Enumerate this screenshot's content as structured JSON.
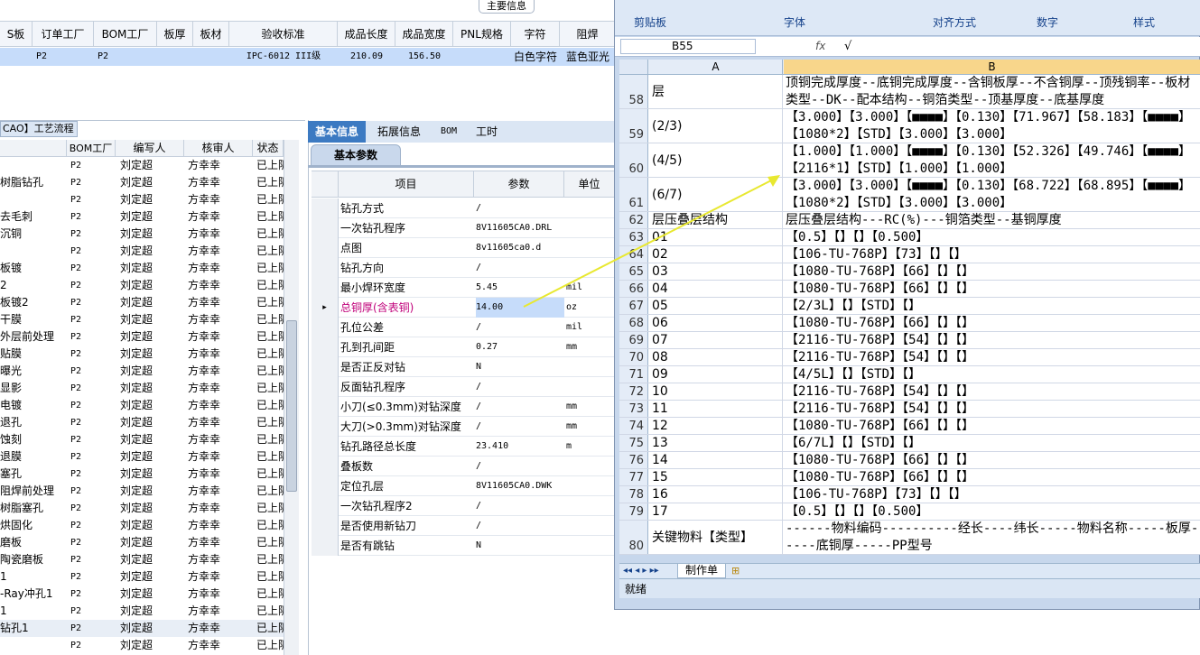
{
  "top_grid": {
    "group_title": "主要信息",
    "headers": [
      "S板",
      "订单工厂",
      "BOM工厂",
      "板厚",
      "板材",
      "验收标准",
      "成品长度",
      "成品宽度",
      "PNL规格",
      "字符",
      "阻焊"
    ],
    "row": [
      "",
      "P2",
      "P2",
      "",
      "",
      "IPC-6012 III级",
      "210.09",
      "156.50",
      "",
      "白色字符",
      "蓝色亚光"
    ]
  },
  "left_list": {
    "title": "CAO】工艺流程",
    "headers": [
      "",
      "BOM工厂",
      "编写人",
      "核审人",
      "状态"
    ],
    "rows": [
      [
        "",
        "P2",
        "刘定超",
        "方幸幸",
        "已上阪"
      ],
      [
        "树脂钻孔",
        "P2",
        "刘定超",
        "方幸幸",
        "已上阪"
      ],
      [
        "",
        "P2",
        "刘定超",
        "方幸幸",
        "已上阪"
      ],
      [
        "去毛刺",
        "P2",
        "刘定超",
        "方幸幸",
        "已上阪"
      ],
      [
        "沉铜",
        "P2",
        "刘定超",
        "方幸幸",
        "已上阪"
      ],
      [
        "",
        "P2",
        "刘定超",
        "方幸幸",
        "已上阪"
      ],
      [
        "板镀",
        "P2",
        "刘定超",
        "方幸幸",
        "已上阪"
      ],
      [
        "2",
        "P2",
        "刘定超",
        "方幸幸",
        "已上阪"
      ],
      [
        "板镀2",
        "P2",
        "刘定超",
        "方幸幸",
        "已上阪"
      ],
      [
        "干膜",
        "P2",
        "刘定超",
        "方幸幸",
        "已上阪"
      ],
      [
        "外层前处理",
        "P2",
        "刘定超",
        "方幸幸",
        "已上阪"
      ],
      [
        "贴膜",
        "P2",
        "刘定超",
        "方幸幸",
        "已上阪"
      ],
      [
        "曝光",
        "P2",
        "刘定超",
        "方幸幸",
        "已上阪"
      ],
      [
        "显影",
        "P2",
        "刘定超",
        "方幸幸",
        "已上阪"
      ],
      [
        "电镀",
        "P2",
        "刘定超",
        "方幸幸",
        "已上阪"
      ],
      [
        "退孔",
        "P2",
        "刘定超",
        "方幸幸",
        "已上阪"
      ],
      [
        "蚀刻",
        "P2",
        "刘定超",
        "方幸幸",
        "已上阪"
      ],
      [
        "退膜",
        "P2",
        "刘定超",
        "方幸幸",
        "已上阪"
      ],
      [
        "塞孔",
        "P2",
        "刘定超",
        "方幸幸",
        "已上阪"
      ],
      [
        "阻焊前处理",
        "P2",
        "刘定超",
        "方幸幸",
        "已上阪"
      ],
      [
        "树脂塞孔",
        "P2",
        "刘定超",
        "方幸幸",
        "已上阪"
      ],
      [
        "烘固化",
        "P2",
        "刘定超",
        "方幸幸",
        "已上阪"
      ],
      [
        "磨板",
        "P2",
        "刘定超",
        "方幸幸",
        "已上阪"
      ],
      [
        "陶瓷磨板",
        "P2",
        "刘定超",
        "方幸幸",
        "已上阪"
      ],
      [
        "1",
        "P2",
        "刘定超",
        "方幸幸",
        "已上阪"
      ],
      [
        "-Ray冲孔1",
        "P2",
        "刘定超",
        "方幸幸",
        "已上阪"
      ],
      [
        "1",
        "P2",
        "刘定超",
        "方幸幸",
        "已上阪"
      ],
      [
        "钻孔1",
        "P2",
        "刘定超",
        "方幸幸",
        "已上阪"
      ],
      [
        "",
        "P2",
        "刘定超",
        "方幸幸",
        "已上阪"
      ]
    ]
  },
  "mid_panel": {
    "tabs": [
      "基本信息",
      "拓展信息",
      "BOM",
      "工时"
    ],
    "subtab": "基本参数",
    "headers": [
      "项目",
      "参数",
      "单位"
    ],
    "rows": [
      [
        "钻孔方式",
        "/",
        ""
      ],
      [
        "一次钻孔程序",
        "8V11605CA0.DRL",
        ""
      ],
      [
        "点图",
        "8v11605ca0.d",
        ""
      ],
      [
        "钻孔方向",
        "/",
        ""
      ],
      [
        "最小焊环宽度",
        "5.45",
        "mil"
      ],
      [
        "总铜厚(含表铜)",
        "14.00",
        "oz"
      ],
      [
        "孔位公差",
        "/",
        "mil"
      ],
      [
        "孔到孔间距",
        "0.27",
        "mm"
      ],
      [
        "是否正反对钻",
        "N",
        ""
      ],
      [
        "反面钻孔程序",
        "/",
        ""
      ],
      [
        "小刀(≤0.3mm)对钻深度",
        "/",
        "mm"
      ],
      [
        "大刀(>0.3mm)对钻深度",
        "/",
        "mm"
      ],
      [
        "钻孔路径总长度",
        "23.410",
        "m"
      ],
      [
        "叠板数",
        "/",
        ""
      ],
      [
        "定位孔层",
        "8V11605CA0.DWK",
        ""
      ],
      [
        "一次钻孔程序2",
        "/",
        ""
      ],
      [
        "是否使用新钻刀",
        "/",
        ""
      ],
      [
        "是否有跳钻",
        "N",
        ""
      ]
    ]
  },
  "excel": {
    "ribbon_groups": [
      "剪贴板",
      "字体",
      "对齐方式",
      "数字",
      "样式"
    ],
    "name_box": "B55",
    "fx": "fx",
    "formula": "√",
    "col_a": "A",
    "col_b": "B",
    "rows": [
      [
        "58",
        "层",
        "顶铜完成厚度--底铜完成厚度--含铜板厚--不含铜厚--顶残铜率--板材类型--DK--配本结构--铜箔类型--顶基厚度--底基厚度"
      ],
      [
        "59",
        "(2/3)",
        "【3.000】【3.000】【■■■■】【0.130】【71.967】【58.183】【■■■■】【1080*2】【STD】【3.000】【3.000】"
      ],
      [
        "60",
        "(4/5)",
        "【1.000】【1.000】【■■■■】【0.130】【52.326】【49.746】【■■■■】【2116*1】【STD】【1.000】【1.000】"
      ],
      [
        "61",
        "(6/7)",
        "【3.000】【3.000】【■■■■】【0.130】【68.722】【68.895】【■■■■】【1080*2】【STD】【3.000】【3.000】"
      ],
      [
        "62",
        "层压叠层结构",
        "层压叠层结构---RC(%)---铜箔类型--基铜厚度"
      ],
      [
        "63",
        "01",
        "【0.5】【】【】【0.500】"
      ],
      [
        "64",
        "02",
        "【106-TU-768P】【73】【】【】"
      ],
      [
        "65",
        "03",
        "【1080-TU-768P】【66】【】【】"
      ],
      [
        "66",
        "04",
        "【1080-TU-768P】【66】【】【】"
      ],
      [
        "67",
        "05",
        "【2/3L】【】【STD】【】"
      ],
      [
        "68",
        "06",
        "【1080-TU-768P】【66】【】【】"
      ],
      [
        "69",
        "07",
        "【2116-TU-768P】【54】【】【】"
      ],
      [
        "70",
        "08",
        "【2116-TU-768P】【54】【】【】"
      ],
      [
        "71",
        "09",
        "【4/5L】【】【STD】【】"
      ],
      [
        "72",
        "10",
        "【2116-TU-768P】【54】【】【】"
      ],
      [
        "73",
        "11",
        "【2116-TU-768P】【54】【】【】"
      ],
      [
        "74",
        "12",
        "【1080-TU-768P】【66】【】【】"
      ],
      [
        "75",
        "13",
        "【6/7L】【】【STD】【】"
      ],
      [
        "76",
        "14",
        "【1080-TU-768P】【66】【】【】"
      ],
      [
        "77",
        "15",
        "【1080-TU-768P】【66】【】【】"
      ],
      [
        "78",
        "16",
        "【106-TU-768P】【73】【】【】"
      ],
      [
        "79",
        "17",
        "【0.5】【】【】【0.500】"
      ],
      [
        "80",
        "关键物料【类型】",
        "------物料编码----------经长----纬长-----物料名称-----板厚-----底铜厚-----PP型号"
      ]
    ],
    "sheet_tab": "制作单",
    "status": "就绪"
  }
}
